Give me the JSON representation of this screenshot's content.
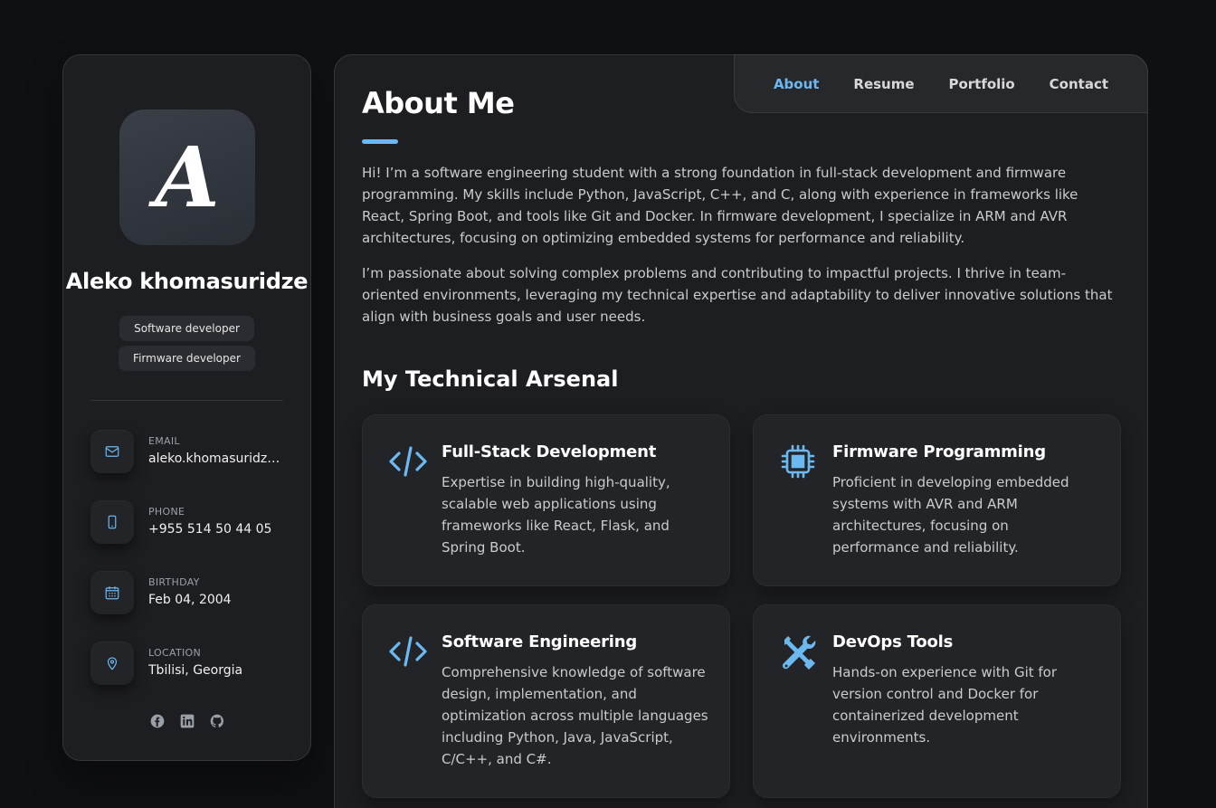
{
  "profile": {
    "avatar_letter": "A",
    "name": "Aleko khomasuridze",
    "roles": [
      "Software developer",
      "Firmware developer"
    ]
  },
  "contacts": [
    {
      "label": "EMAIL",
      "value": "aleko.khomasuridze...",
      "icon": "mail-icon"
    },
    {
      "label": "PHONE",
      "value": "+955 514 50 44 05",
      "icon": "phone-icon"
    },
    {
      "label": "BIRTHDAY",
      "value": "Feb 04, 2004",
      "icon": "calendar-icon"
    },
    {
      "label": "LOCATION",
      "value": "Tbilisi, Georgia",
      "icon": "location-pin-icon"
    }
  ],
  "socials": [
    "facebook-icon",
    "linkedin-icon",
    "github-icon"
  ],
  "nav": {
    "items": [
      "About",
      "Resume",
      "Portfolio",
      "Contact"
    ],
    "active": "About"
  },
  "about": {
    "title": "About Me",
    "paragraphs": [
      "Hi! I’m a software engineering student with a strong foundation in full-stack development and firmware programming. My skills include Python, JavaScript, C++, and C, along with experience in frameworks like React, Spring Boot, and tools like Git and Docker. In firmware development, I specialize in ARM and AVR architectures, focusing on optimizing embedded systems for performance and reliability.",
      "I’m passionate about solving complex problems and contributing to impactful projects. I thrive in team-oriented environments, leveraging my technical expertise and adaptability to deliver innovative solutions that align with business goals and user needs."
    ]
  },
  "arsenal": {
    "title": "My Technical Arsenal",
    "cards": [
      {
        "icon": "code-icon",
        "title": "Full-Stack Development",
        "text": "Expertise in building high-quality, scalable web applications using frameworks like React, Flask, and Spring Boot."
      },
      {
        "icon": "chip-icon",
        "title": "Firmware Programming",
        "text": "Proficient in developing embedded systems with AVR and ARM architectures, focusing on performance and reliability."
      },
      {
        "icon": "code-icon",
        "title": "Software Engineering",
        "text": "Comprehensive knowledge of software design, implementation, and optimization across multiple languages including Python, Java, JavaScript, C/C++, and C#."
      },
      {
        "icon": "tools-icon",
        "title": "DevOps Tools",
        "text": "Hands-on experience with Git for version control and Docker for containerized development environments."
      }
    ]
  },
  "colors": {
    "accent": "#6cb9f2",
    "background": "#0f1013",
    "panel": "#1d1e21"
  }
}
